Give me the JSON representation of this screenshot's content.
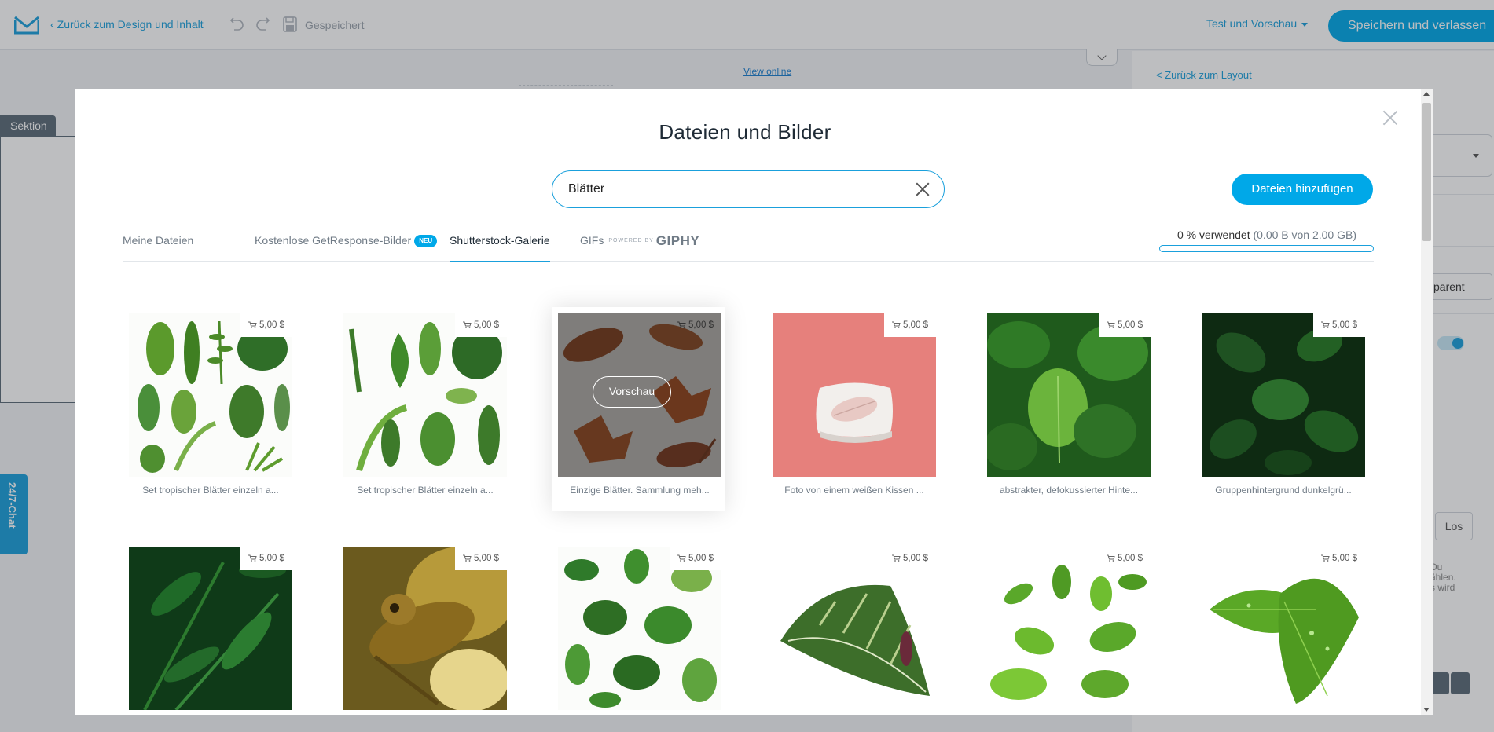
{
  "topbar": {
    "back_label": "Zurück zum Design und Inhalt",
    "saved_label": "Gespeichert",
    "preview_menu_label": "Test und Vorschau",
    "save_exit_label": "Speichern und verlassen"
  },
  "editor": {
    "view_online_label": "View online",
    "section_label": "Sektion",
    "chat_label": "24/7-Chat"
  },
  "right_panel": {
    "back_label": "< Zurück zum Layout",
    "transparent_label": "parent",
    "los_label": "Los",
    "note_lines": [
      "Du",
      "ählen.",
      "s wird"
    ]
  },
  "modal": {
    "title": "Dateien und Bilder",
    "search": {
      "value": "Blätter"
    },
    "add_files_label": "Dateien hinzufügen",
    "tabs": [
      {
        "label": "Meine Dateien"
      },
      {
        "label": "Kostenlose GetResponse-Bilder",
        "badge": "NEU"
      },
      {
        "label": "Shutterstock-Galerie"
      },
      {
        "label": "GIFs",
        "powered": "POWERED BY",
        "brand": "GIPHY"
      }
    ],
    "usage": {
      "percent_text": "0 % verwendet",
      "detail_text": "(0.00 B von 2.00 GB)",
      "fraction": 0.0
    },
    "preview_label": "Vorschau",
    "images": [
      {
        "title": "Set tropischer Blätter einzeln a...",
        "price": "5,00 $",
        "theme": "tropical-leaves-set"
      },
      {
        "title": "Set tropischer Blätter einzeln a...",
        "price": "5,00 $",
        "theme": "tropical-leaves-set-2"
      },
      {
        "title": "Einzige Blätter. Sammlung meh...",
        "price": "5,00 $",
        "theme": "autumn-leaves"
      },
      {
        "title": "Foto von einem weißen Kissen ...",
        "price": "5,00 $",
        "theme": "pillow-pink"
      },
      {
        "title": "abstrakter, defokussierter Hinte...",
        "price": "5,00 $",
        "theme": "defocused-green"
      },
      {
        "title": "Gruppenhintergrund dunkelgrü...",
        "price": "5,00 $",
        "theme": "dark-green"
      },
      {
        "title": "",
        "price": "5,00 $",
        "theme": "fern-dark"
      },
      {
        "title": "",
        "price": "5,00 $",
        "theme": "grasshopper"
      },
      {
        "title": "",
        "price": "5,00 $",
        "theme": "monstera-pattern"
      },
      {
        "title": "",
        "price": "5,00 $",
        "theme": "calathea-leaf"
      },
      {
        "title": "",
        "price": "5,00 $",
        "theme": "tea-leaves"
      },
      {
        "title": "",
        "price": "5,00 $",
        "theme": "fresh-leaf-drops"
      }
    ]
  },
  "colors": {
    "accent": "#00a8e8",
    "link": "#1aa0dc"
  }
}
